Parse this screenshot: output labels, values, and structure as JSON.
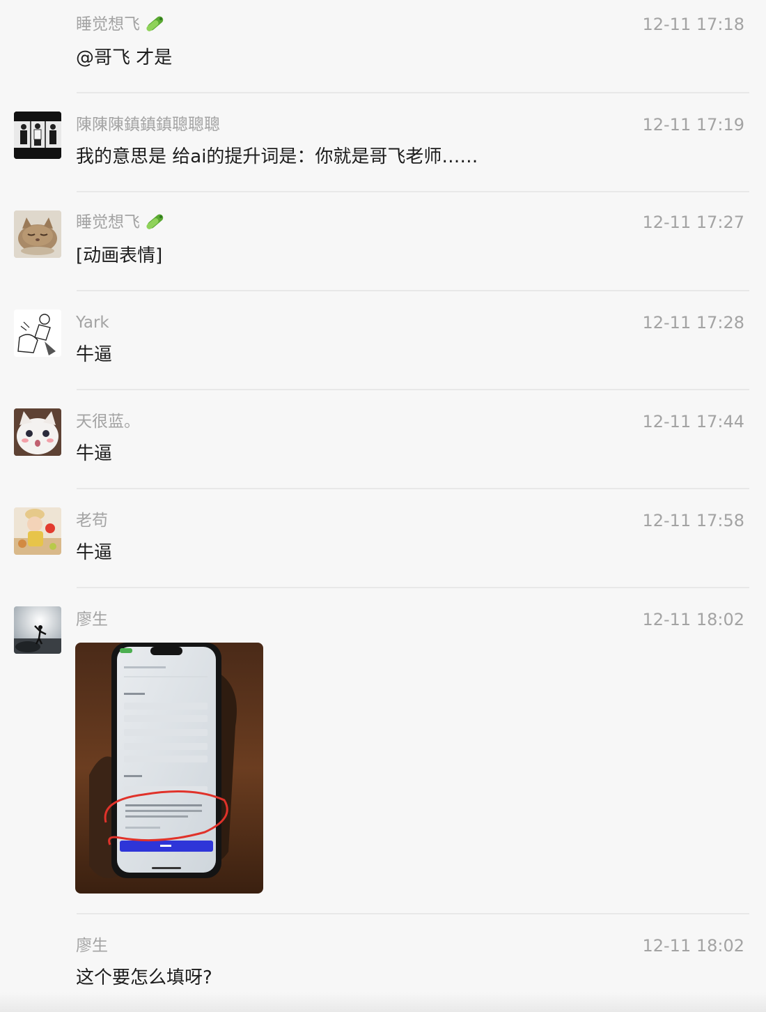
{
  "messages": [
    {
      "name": "睡觉想飞",
      "time": "12-11 17:18",
      "text": "@哥飞 才是"
    },
    {
      "name": "陳陳陳鎮鎮鎮聰聰聰",
      "time": "12-11 17:19",
      "text": "我的意思是 给ai的提升词是：你就是哥飞老师……"
    },
    {
      "name": "睡觉想飞",
      "time": "12-11 17:27",
      "text": "[动画表情]"
    },
    {
      "name": "Yark",
      "time": "12-11 17:28",
      "text": "牛逼"
    },
    {
      "name": "天很蓝。",
      "time": "12-11 17:44",
      "text": "牛逼"
    },
    {
      "name": "老苟",
      "time": "12-11 17:58",
      "text": "牛逼"
    },
    {
      "name": "廖生",
      "time": "12-11 18:02",
      "text": ""
    },
    {
      "name": "廖生",
      "time": "12-11 18:02",
      "text": "这个要怎么填呀?"
    }
  ],
  "icons": {
    "badge": "cucumber-emoji-icon"
  },
  "colors": {
    "background": "#f7f7f7",
    "name_text": "#a3a3a3",
    "message_text": "#1c1c1c",
    "separator": "#e8e8e8",
    "circle_annotation": "#e0322a",
    "phone_button": "#2e35d8"
  }
}
